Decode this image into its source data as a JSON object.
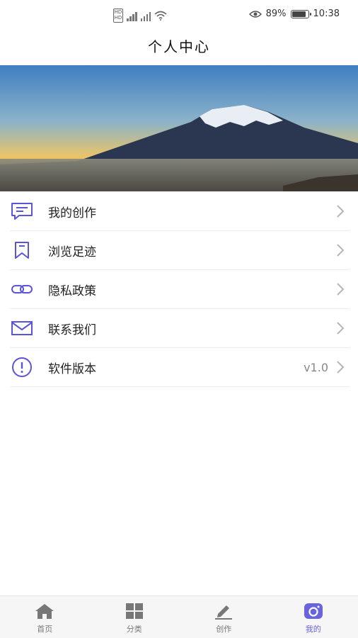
{
  "status_bar": {
    "battery": "89%",
    "time": "10:38",
    "battery_level": 0.89
  },
  "header": {
    "title": "个人中心"
  },
  "menu": {
    "items": [
      {
        "label": "我的创作",
        "value": "",
        "icon": "message-icon"
      },
      {
        "label": "浏览足迹",
        "value": "",
        "icon": "bookmark-icon"
      },
      {
        "label": "隐私政策",
        "value": "",
        "icon": "link-icon"
      },
      {
        "label": "联系我们",
        "value": "",
        "icon": "mail-icon"
      },
      {
        "label": "软件版本",
        "value": "v1.0",
        "icon": "info-icon"
      }
    ]
  },
  "tabbar": {
    "tabs": [
      {
        "label": "首页",
        "icon": "home-icon",
        "active": false
      },
      {
        "label": "分类",
        "icon": "grid-icon",
        "active": false
      },
      {
        "label": "创作",
        "icon": "pen-icon",
        "active": false
      },
      {
        "label": "我的",
        "icon": "camera-icon",
        "active": true
      }
    ]
  },
  "colors": {
    "accent": "#6a63e0",
    "icon": "#5a55d8",
    "inactive": "#777777"
  }
}
